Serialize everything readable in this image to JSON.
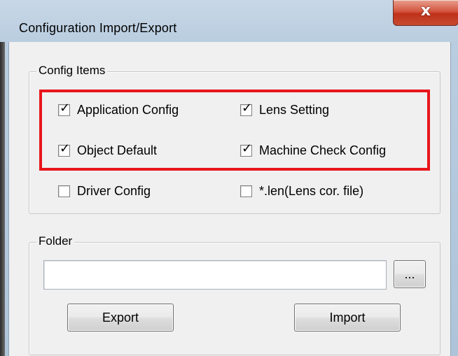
{
  "window": {
    "title": "Configuration Import/Export",
    "close_glyph": "x"
  },
  "config_items": {
    "label": "Config Items",
    "items": [
      {
        "label": "Application Config",
        "checked": true
      },
      {
        "label": "Lens Setting",
        "checked": true
      },
      {
        "label": "Object Default",
        "checked": true
      },
      {
        "label": "Machine Check Config",
        "checked": true
      },
      {
        "label": "Driver Config",
        "checked": false
      },
      {
        "label": "*.len(Lens cor. file)",
        "checked": false
      }
    ]
  },
  "folder": {
    "label": "Folder",
    "path_value": "",
    "browse_label": "..."
  },
  "actions": {
    "export_label": "Export",
    "import_label": "Import"
  },
  "colors": {
    "highlight": "#e8151b",
    "dialog_bg": "#f0f0f0",
    "close_button": "#c0311a"
  }
}
